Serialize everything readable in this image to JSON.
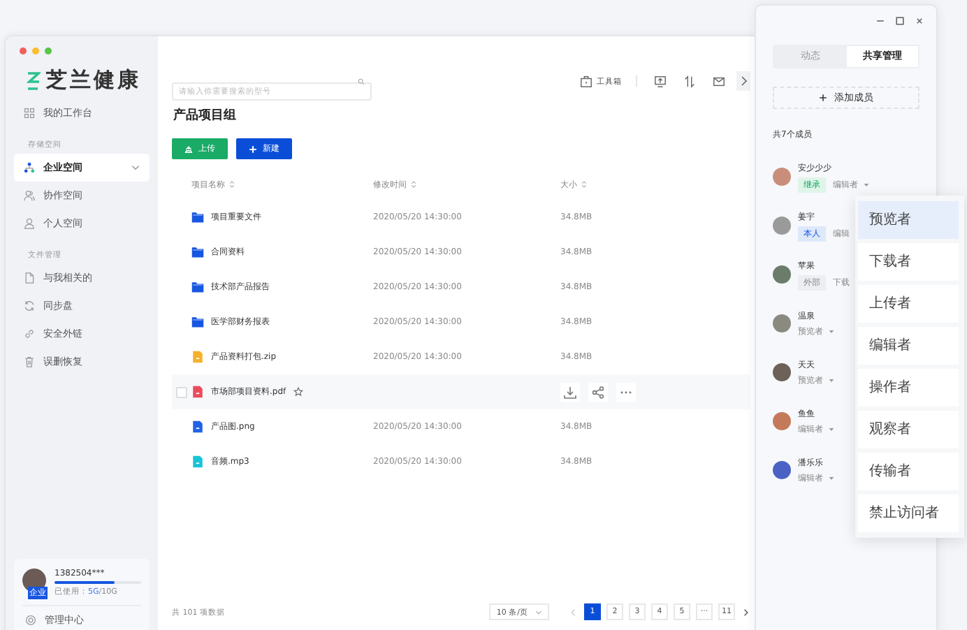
{
  "window": {
    "dots": [
      {
        "color": "#f25f58"
      },
      {
        "color": "#fbbe2e"
      },
      {
        "color": "#58c645"
      }
    ]
  },
  "logo": {
    "text": "芝兰健康"
  },
  "sidebar": {
    "top_item": {
      "label": "我的工作台",
      "selected": false
    },
    "sections": [
      {
        "title": "存储空间",
        "items": [
          {
            "label": "企业空间",
            "selected": true,
            "expandable": true
          },
          {
            "label": "协作空间",
            "selected": false,
            "expandable": false
          },
          {
            "label": "个人空间",
            "selected": false,
            "expandable": false
          }
        ]
      },
      {
        "title": "文件管理",
        "items": [
          {
            "label": "与我相关的",
            "selected": false,
            "expandable": false
          },
          {
            "label": "同步盘",
            "selected": false,
            "expandable": false
          },
          {
            "label": "安全外链",
            "selected": false,
            "expandable": false
          },
          {
            "label": "误删恢复",
            "selected": false,
            "expandable": false
          }
        ]
      }
    ],
    "user": {
      "phone": "1382504***",
      "badge": "企业",
      "usage_label": "已使用：",
      "used": "5G",
      "total": "/10G",
      "level": 0.7
    },
    "admin": {
      "label": "管理中心"
    }
  },
  "toolbar": {
    "search": {
      "placeholder": "请输入你需要搜索的型号"
    },
    "toolbox": "工具箱"
  },
  "title": "产品项目组",
  "actions": [
    {
      "label": "上传",
      "kind": "upload"
    },
    {
      "label": "新建",
      "kind": "new"
    }
  ],
  "table": {
    "columns": [
      "项目名称",
      "修改时间",
      "大小"
    ],
    "rows": [
      {
        "name": "项目重要文件",
        "kind": "folder",
        "time": "2020/05/20 14:30:00",
        "size": "34.8MB",
        "hovered": false
      },
      {
        "name": "合同资料",
        "kind": "folder",
        "time": "2020/05/20 14:30:00",
        "size": "34.8MB",
        "hovered": false
      },
      {
        "name": "技术部产品报告",
        "kind": "folder",
        "time": "2020/05/20 14:30:00",
        "size": "34.8MB",
        "hovered": false
      },
      {
        "name": "医学部财务报表",
        "kind": "folder",
        "time": "2020/05/20 14:30:00",
        "size": "34.8MB",
        "hovered": false
      },
      {
        "name": "产品资料打包.zip",
        "kind": "zip",
        "time": "2020/05/20 14:30:00",
        "size": "34.8MB",
        "hovered": false
      },
      {
        "name": "市场部项目资料.pdf",
        "kind": "pdf",
        "hovered": true
      },
      {
        "name": "产品图.png",
        "kind": "image",
        "time": "2020/05/20 14:30:00",
        "size": "34.8MB",
        "hovered": false
      },
      {
        "name": "音频.mp3",
        "kind": "audio",
        "time": "2020/05/20 14:30:00",
        "size": "34.8MB",
        "hovered": false
      }
    ]
  },
  "footer": {
    "total": "共 101 项数据",
    "page_size": "10 条/页",
    "pages": [
      {
        "label": "1",
        "selected": true
      },
      {
        "label": "2",
        "selected": false
      },
      {
        "label": "3",
        "selected": false
      },
      {
        "label": "4",
        "selected": false
      },
      {
        "label": "5",
        "selected": false
      },
      {
        "label": "···",
        "selected": false
      },
      {
        "label": "11",
        "selected": false
      }
    ]
  },
  "panel": {
    "tabs": [
      {
        "label": "动态",
        "selected": false
      },
      {
        "label": "共享管理",
        "selected": true
      }
    ],
    "add_member": "添加成员",
    "count": "共7个成员",
    "members": [
      {
        "name": "安少少少",
        "tag": {
          "text": "继承",
          "kind": "inherit"
        },
        "role": "编辑者"
      },
      {
        "name": "姜宇",
        "tag": {
          "text": "本人",
          "kind": "self"
        },
        "role": "编辑"
      },
      {
        "name": "苹果",
        "tag": {
          "text": "外部",
          "kind": "external"
        },
        "role": "下载"
      },
      {
        "name": "温泉",
        "role": "预览者"
      },
      {
        "name": "天天",
        "role": "预览者"
      },
      {
        "name": "鱼鱼",
        "role": "编辑者"
      },
      {
        "name": "潘乐乐",
        "role": "编辑者"
      }
    ],
    "role_menu": [
      {
        "label": "预览者",
        "selected": true
      },
      {
        "label": "下载者",
        "selected": false
      },
      {
        "label": "上传者",
        "selected": false
      },
      {
        "label": "编辑者",
        "selected": false
      },
      {
        "label": "操作者",
        "selected": false
      },
      {
        "label": "观察者",
        "selected": false
      },
      {
        "label": "传输者",
        "selected": false
      },
      {
        "label": "禁止访问者",
        "selected": false
      }
    ]
  }
}
